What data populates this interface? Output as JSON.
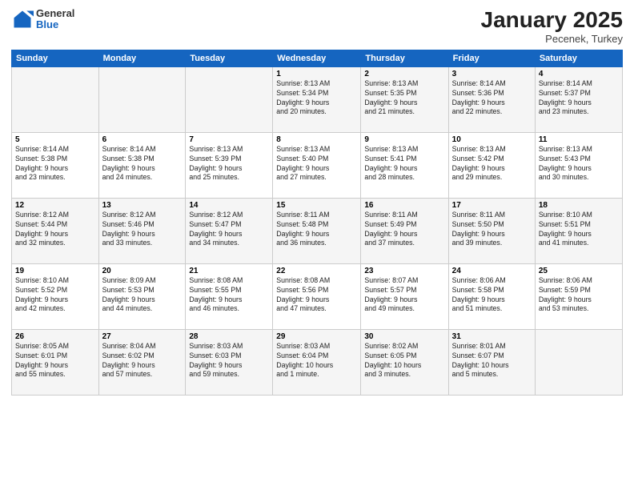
{
  "header": {
    "logo": {
      "general": "General",
      "blue": "Blue"
    },
    "month": "January 2025",
    "location": "Pecenek, Turkey"
  },
  "calendar": {
    "days_of_week": [
      "Sunday",
      "Monday",
      "Tuesday",
      "Wednesday",
      "Thursday",
      "Friday",
      "Saturday"
    ],
    "weeks": [
      [
        {
          "day": "",
          "info": ""
        },
        {
          "day": "",
          "info": ""
        },
        {
          "day": "",
          "info": ""
        },
        {
          "day": "1",
          "info": "Sunrise: 8:13 AM\nSunset: 5:34 PM\nDaylight: 9 hours\nand 20 minutes."
        },
        {
          "day": "2",
          "info": "Sunrise: 8:13 AM\nSunset: 5:35 PM\nDaylight: 9 hours\nand 21 minutes."
        },
        {
          "day": "3",
          "info": "Sunrise: 8:14 AM\nSunset: 5:36 PM\nDaylight: 9 hours\nand 22 minutes."
        },
        {
          "day": "4",
          "info": "Sunrise: 8:14 AM\nSunset: 5:37 PM\nDaylight: 9 hours\nand 23 minutes."
        }
      ],
      [
        {
          "day": "5",
          "info": "Sunrise: 8:14 AM\nSunset: 5:38 PM\nDaylight: 9 hours\nand 23 minutes."
        },
        {
          "day": "6",
          "info": "Sunrise: 8:14 AM\nSunset: 5:38 PM\nDaylight: 9 hours\nand 24 minutes."
        },
        {
          "day": "7",
          "info": "Sunrise: 8:13 AM\nSunset: 5:39 PM\nDaylight: 9 hours\nand 25 minutes."
        },
        {
          "day": "8",
          "info": "Sunrise: 8:13 AM\nSunset: 5:40 PM\nDaylight: 9 hours\nand 27 minutes."
        },
        {
          "day": "9",
          "info": "Sunrise: 8:13 AM\nSunset: 5:41 PM\nDaylight: 9 hours\nand 28 minutes."
        },
        {
          "day": "10",
          "info": "Sunrise: 8:13 AM\nSunset: 5:42 PM\nDaylight: 9 hours\nand 29 minutes."
        },
        {
          "day": "11",
          "info": "Sunrise: 8:13 AM\nSunset: 5:43 PM\nDaylight: 9 hours\nand 30 minutes."
        }
      ],
      [
        {
          "day": "12",
          "info": "Sunrise: 8:12 AM\nSunset: 5:44 PM\nDaylight: 9 hours\nand 32 minutes."
        },
        {
          "day": "13",
          "info": "Sunrise: 8:12 AM\nSunset: 5:46 PM\nDaylight: 9 hours\nand 33 minutes."
        },
        {
          "day": "14",
          "info": "Sunrise: 8:12 AM\nSunset: 5:47 PM\nDaylight: 9 hours\nand 34 minutes."
        },
        {
          "day": "15",
          "info": "Sunrise: 8:11 AM\nSunset: 5:48 PM\nDaylight: 9 hours\nand 36 minutes."
        },
        {
          "day": "16",
          "info": "Sunrise: 8:11 AM\nSunset: 5:49 PM\nDaylight: 9 hours\nand 37 minutes."
        },
        {
          "day": "17",
          "info": "Sunrise: 8:11 AM\nSunset: 5:50 PM\nDaylight: 9 hours\nand 39 minutes."
        },
        {
          "day": "18",
          "info": "Sunrise: 8:10 AM\nSunset: 5:51 PM\nDaylight: 9 hours\nand 41 minutes."
        }
      ],
      [
        {
          "day": "19",
          "info": "Sunrise: 8:10 AM\nSunset: 5:52 PM\nDaylight: 9 hours\nand 42 minutes."
        },
        {
          "day": "20",
          "info": "Sunrise: 8:09 AM\nSunset: 5:53 PM\nDaylight: 9 hours\nand 44 minutes."
        },
        {
          "day": "21",
          "info": "Sunrise: 8:08 AM\nSunset: 5:55 PM\nDaylight: 9 hours\nand 46 minutes."
        },
        {
          "day": "22",
          "info": "Sunrise: 8:08 AM\nSunset: 5:56 PM\nDaylight: 9 hours\nand 47 minutes."
        },
        {
          "day": "23",
          "info": "Sunrise: 8:07 AM\nSunset: 5:57 PM\nDaylight: 9 hours\nand 49 minutes."
        },
        {
          "day": "24",
          "info": "Sunrise: 8:06 AM\nSunset: 5:58 PM\nDaylight: 9 hours\nand 51 minutes."
        },
        {
          "day": "25",
          "info": "Sunrise: 8:06 AM\nSunset: 5:59 PM\nDaylight: 9 hours\nand 53 minutes."
        }
      ],
      [
        {
          "day": "26",
          "info": "Sunrise: 8:05 AM\nSunset: 6:01 PM\nDaylight: 9 hours\nand 55 minutes."
        },
        {
          "day": "27",
          "info": "Sunrise: 8:04 AM\nSunset: 6:02 PM\nDaylight: 9 hours\nand 57 minutes."
        },
        {
          "day": "28",
          "info": "Sunrise: 8:03 AM\nSunset: 6:03 PM\nDaylight: 9 hours\nand 59 minutes."
        },
        {
          "day": "29",
          "info": "Sunrise: 8:03 AM\nSunset: 6:04 PM\nDaylight: 10 hours\nand 1 minute."
        },
        {
          "day": "30",
          "info": "Sunrise: 8:02 AM\nSunset: 6:05 PM\nDaylight: 10 hours\nand 3 minutes."
        },
        {
          "day": "31",
          "info": "Sunrise: 8:01 AM\nSunset: 6:07 PM\nDaylight: 10 hours\nand 5 minutes."
        },
        {
          "day": "",
          "info": ""
        }
      ]
    ]
  }
}
